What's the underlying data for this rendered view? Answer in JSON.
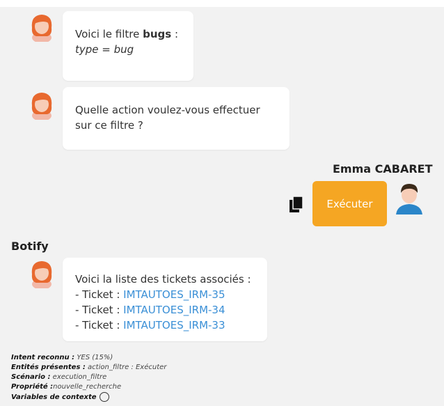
{
  "messages": {
    "m1": {
      "line1_prefix": "Voici le filtre ",
      "line1_bold": "bugs",
      "line1_suffix": " :",
      "line2": "type = bug"
    },
    "m2": {
      "line1": "Quelle action voulez-vous effectuer",
      "line2": "sur ce filtre ?"
    },
    "user": {
      "name": "Emma CABARET",
      "button": "Exécuter"
    },
    "bot": {
      "name": "Botify"
    },
    "m3": {
      "intro": "Voici la liste des tickets associés :",
      "tickets": [
        {
          "prefix": "- Ticket : ",
          "id": "IMTAUTOES_IRM-35"
        },
        {
          "prefix": "- Ticket : ",
          "id": "IMTAUTOES_IRM-34"
        },
        {
          "prefix": "- Ticket : ",
          "id": "IMTAUTOES_IRM-33"
        }
      ]
    }
  },
  "meta": {
    "intent_key": "Intent reconnu :",
    "intent_val": " YES (15%)",
    "entities_key": "Entités présentes :",
    "entities_val": " action_filtre : Exécuter",
    "scenario_key": "Scénario :",
    "scenario_val": " execution_filtre",
    "property_key": "Propriété :",
    "property_val": "nouvelle_recherche",
    "vars_key": "Variables de contexte"
  },
  "colors": {
    "accent": "#f5a623",
    "link": "#3a8fd6"
  },
  "icons": {
    "copy": "copy-icon",
    "info": "info-icon"
  }
}
